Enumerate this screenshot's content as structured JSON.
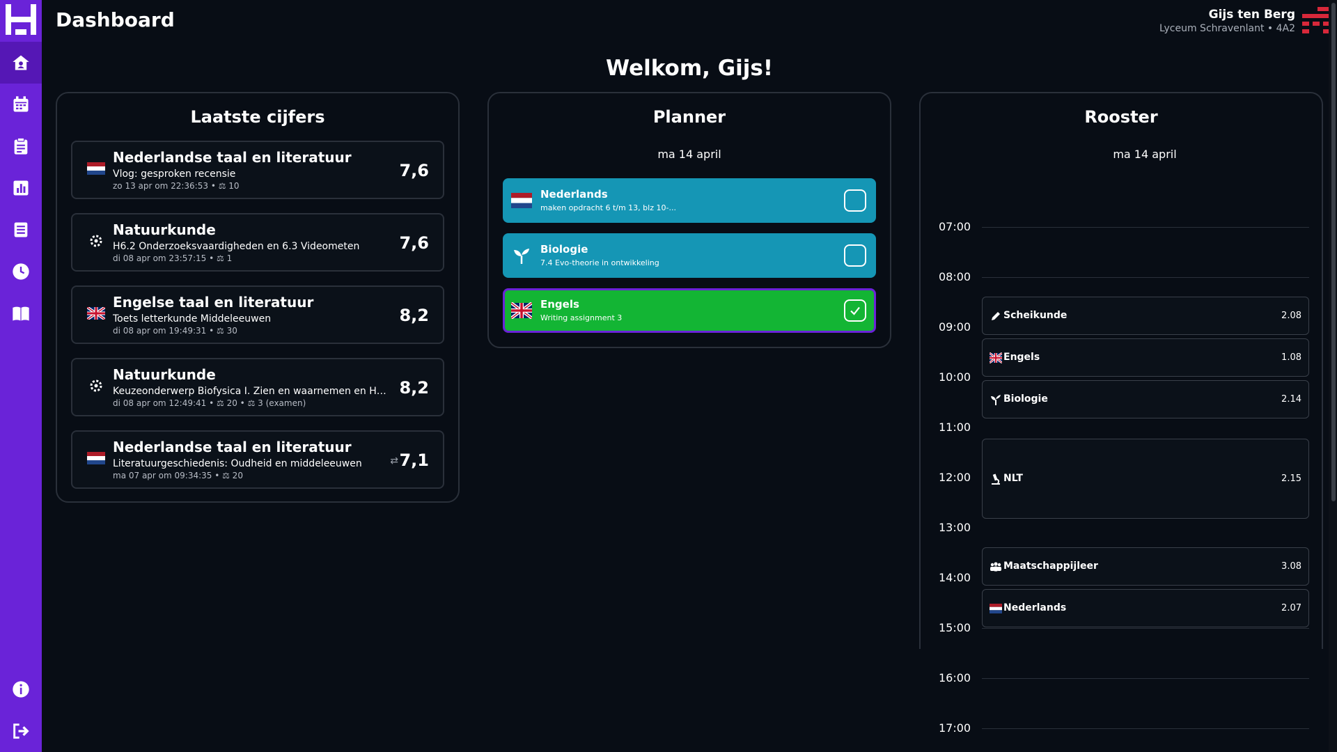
{
  "app": {
    "page_title": "Dashboard",
    "welcome": "Welkom, Gijs!"
  },
  "user": {
    "name": "Gijs ten Berg",
    "school": "Lyceum Schravenlant • 4A2"
  },
  "colors": {
    "sidebar": "#6a23d8",
    "task_open": "#1596b5",
    "task_done": "#13b534",
    "background": "#080d15"
  },
  "sidebar": {
    "items": [
      {
        "icon": "home-icon",
        "active": true
      },
      {
        "icon": "calendar-icon"
      },
      {
        "icon": "clipboard-icon"
      },
      {
        "icon": "chart-icon"
      },
      {
        "icon": "book-icon"
      },
      {
        "icon": "clock-icon"
      },
      {
        "icon": "open-book-icon"
      }
    ],
    "bottom": [
      {
        "icon": "info-icon"
      },
      {
        "icon": "logout-icon"
      }
    ]
  },
  "grades": {
    "title": "Laatste cijfers",
    "items": [
      {
        "icon": "dutch-flag-icon",
        "subject": "Nederlandse taal en literatuur",
        "description": "Vlog: gesproken recensie",
        "meta": "zo 13 apr om 22:36:53 • ⚖ 10",
        "value": "7,6"
      },
      {
        "icon": "atom-icon",
        "subject": "Natuurkunde",
        "description": "H6.2 Onderzoeksvaardigheden en 6.3 Videometen",
        "meta": "di 08 apr om 23:57:15 • ⚖ 1",
        "value": "7,6"
      },
      {
        "icon": "uk-flag-icon",
        "subject": "Engelse taal en literatuur",
        "description": "Toets letterkunde Middeleeuwen",
        "meta": "di 08 apr om 19:49:31 • ⚖ 30",
        "value": "8,2"
      },
      {
        "icon": "atom-icon",
        "subject": "Natuurkunde",
        "description": "Keuzeonderwerp Biofysica I. Zien en waarnemen en Hefbo...",
        "meta": "di 08 apr om 12:49:41 • ⚖ 20 • ⚖ 3 (examen)",
        "value": "8,2"
      },
      {
        "icon": "dutch-flag-icon",
        "subject": "Nederlandse taal en literatuur",
        "description": "Literatuurgeschiedenis: Oudheid en middeleeuwen",
        "meta": "ma 07 apr om 09:34:35 • ⚖ 20",
        "value": "7,1",
        "retake": true
      }
    ]
  },
  "planner": {
    "title": "Planner",
    "date": "ma 14 april",
    "tasks": [
      {
        "icon": "dutch-flag-icon",
        "title": "Nederlands",
        "description": "maken opdracht 6 t/m 13, blz 10-...",
        "done": false
      },
      {
        "icon": "sprout-icon",
        "title": "Biologie",
        "description": "7.4 Evo-theorie in ontwikkeling",
        "done": false
      },
      {
        "icon": "uk-flag-icon",
        "title": "Engels",
        "description": "Writing assignment 3",
        "done": true
      }
    ]
  },
  "schedule": {
    "title": "Rooster",
    "date": "ma 14 april",
    "hours": [
      "07:00",
      "08:00",
      "09:00",
      "10:00",
      "11:00",
      "12:00",
      "13:00",
      "14:00",
      "15:00",
      "16:00",
      "17:00"
    ],
    "lessons": [
      {
        "icon": "pencil-icon",
        "name": "Scheikunde",
        "room": "2.08"
      },
      {
        "icon": "uk-flag-icon",
        "name": "Engels",
        "room": "1.08"
      },
      {
        "icon": "sprout-icon",
        "name": "Biologie",
        "room": "2.14"
      },
      {
        "icon": "microscope-icon",
        "name": "NLT",
        "room": "2.15"
      },
      {
        "icon": "people-icon",
        "name": "Maatschappijleer",
        "room": "3.08"
      },
      {
        "icon": "dutch-flag-icon",
        "name": "Nederlands",
        "room": "2.07"
      }
    ]
  }
}
